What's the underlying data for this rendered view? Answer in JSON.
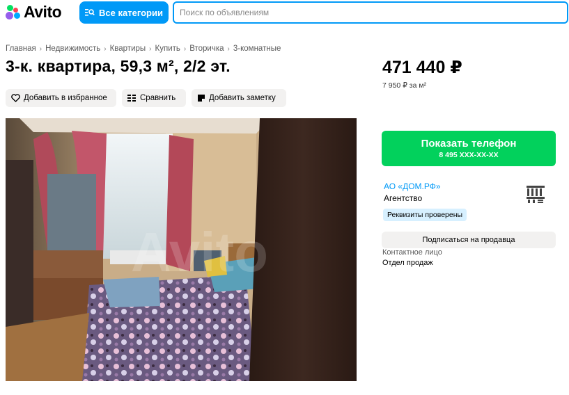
{
  "header": {
    "logo_text": "Avito",
    "categories_button": "Все категории",
    "search_placeholder": "Поиск по объявлениям"
  },
  "breadcrumbs": [
    "Главная",
    "Недвижимость",
    "Квартиры",
    "Купить",
    "Вторичка",
    "3-комнатные"
  ],
  "listing": {
    "title": "3-к. квартира, 59,3 м², 2/2 эт.",
    "actions": {
      "favorite": "Добавить в избранное",
      "compare": "Сравнить",
      "note": "Добавить заметку"
    },
    "photo_watermark": "Avito"
  },
  "sidebar": {
    "price": "471 440 ₽",
    "price_per_m2": "7 950 ₽ за м²",
    "phone_button": "Показать телефон",
    "phone_masked": "8 495 XXX-XX-XX",
    "seller_name": "АО «ДОМ.РФ»",
    "seller_type": "Агентство",
    "verified_badge": "Реквизиты проверены",
    "subscribe_button": "Подписаться на продавца",
    "contact_label": "Контактное лицо",
    "contact_value": "Отдел продаж"
  },
  "colors": {
    "accent_blue": "#0099f7",
    "phone_green": "#02d15c",
    "button_gray": "#f2f1f0",
    "badge_blue": "#d7f0ff"
  }
}
